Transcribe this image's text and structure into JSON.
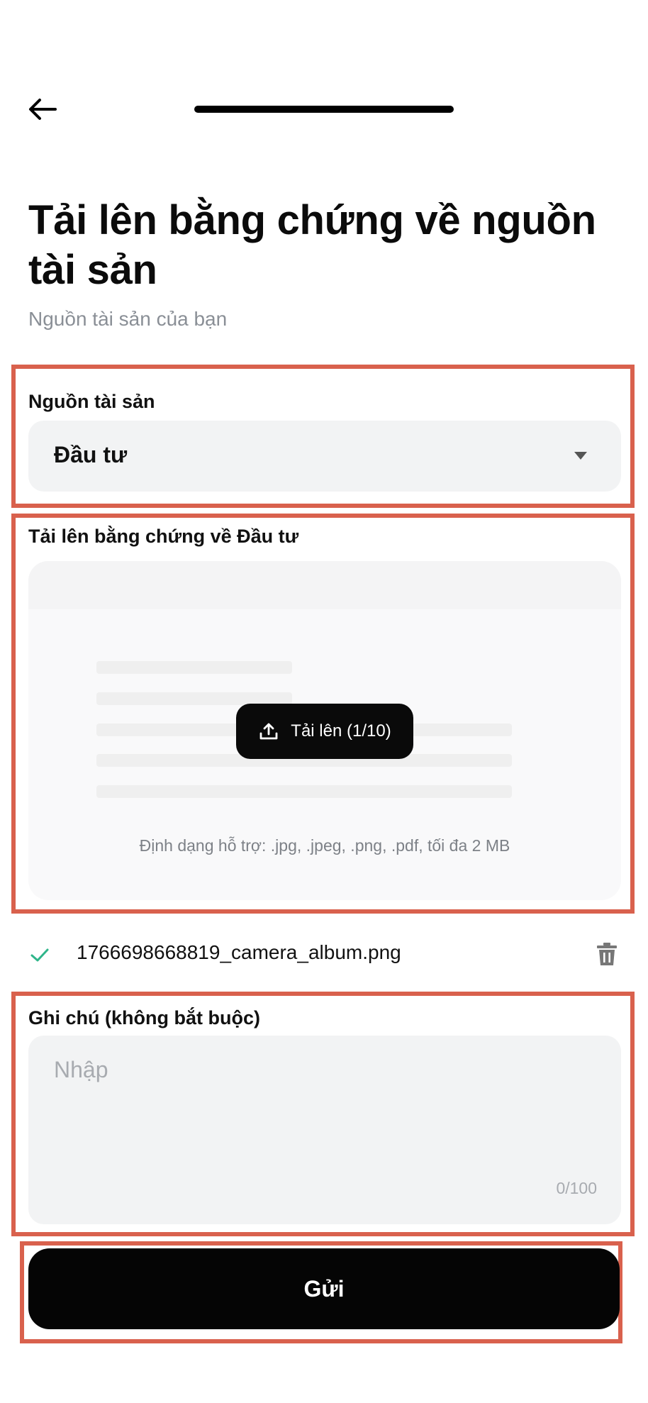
{
  "header": {
    "back_icon": "arrow-left-icon"
  },
  "page": {
    "title": "Tải lên bằng chứng về nguồn tài sản",
    "subtitle": "Nguồn tài sản của bạn"
  },
  "source_field": {
    "label": "Nguồn tài sản",
    "value": "Đầu tư",
    "icon": "caret-down-icon"
  },
  "upload_field": {
    "label": "Tải lên bằng chứng về Đầu tư",
    "button_label": "Tải lên (1/10)",
    "button_icon": "upload-icon",
    "hint": "Định dạng hỗ trợ: .jpg, .jpeg, .png, .pdf, tối đa 2 MB"
  },
  "uploaded_file": {
    "name": "1766698668819_camera_album.png",
    "status_icon": "check-icon",
    "delete_icon": "trash-icon"
  },
  "note_field": {
    "label": "Ghi chú (không bắt buộc)",
    "placeholder": "Nhập",
    "counter": "0/100"
  },
  "submit": {
    "label": "Gửi"
  },
  "colors": {
    "highlight": "#d9614d",
    "field_bg": "#f2f3f4",
    "primary_btn": "#050505",
    "check": "#2fb58a"
  }
}
